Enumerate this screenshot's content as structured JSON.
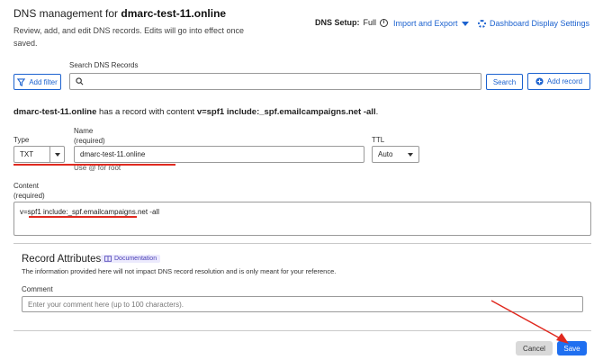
{
  "header": {
    "title_prefix": "DNS management for ",
    "domain": "dmarc-test-11.online",
    "subtitle": "Review, add, and edit DNS records. Edits will go into effect once saved.",
    "dns_setup_label": "DNS Setup:",
    "dns_setup_value": "Full",
    "import_export": "Import and Export",
    "dashboard_settings": "Dashboard Display Settings"
  },
  "toolbar": {
    "add_filter": "Add filter",
    "search_label": "Search DNS Records",
    "search_value": "",
    "search_button": "Search",
    "add_record": "Add record"
  },
  "notice": {
    "domain": "dmarc-test-11.online",
    "middle": " has a record with content ",
    "content": "v=spf1 include:_spf.emailcampaigns.net -all",
    "end": "."
  },
  "form": {
    "type_label": "Type",
    "type_value": "TXT",
    "name_label": "Name",
    "name_required": "(required)",
    "name_value": "dmarc-test-11.online",
    "name_hint": "Use @ for root",
    "ttl_label": "TTL",
    "ttl_value": "Auto",
    "content_label": "Content",
    "content_required": "(required)",
    "content_value": "v=spf1 include:_spf.emailcampaigns.net -all"
  },
  "attributes": {
    "title": "Record Attributes",
    "doc_badge": "Documentation",
    "description": "The information provided here will not impact DNS record resolution and is only meant for your reference.",
    "comment_label": "Comment",
    "comment_placeholder": "Enter your comment here (up to 100 characters)."
  },
  "actions": {
    "cancel": "Cancel",
    "save": "Save"
  },
  "colors": {
    "accent": "#1c62cf",
    "save_button": "#1f6ff0",
    "annotation_red": "#e0291f"
  }
}
